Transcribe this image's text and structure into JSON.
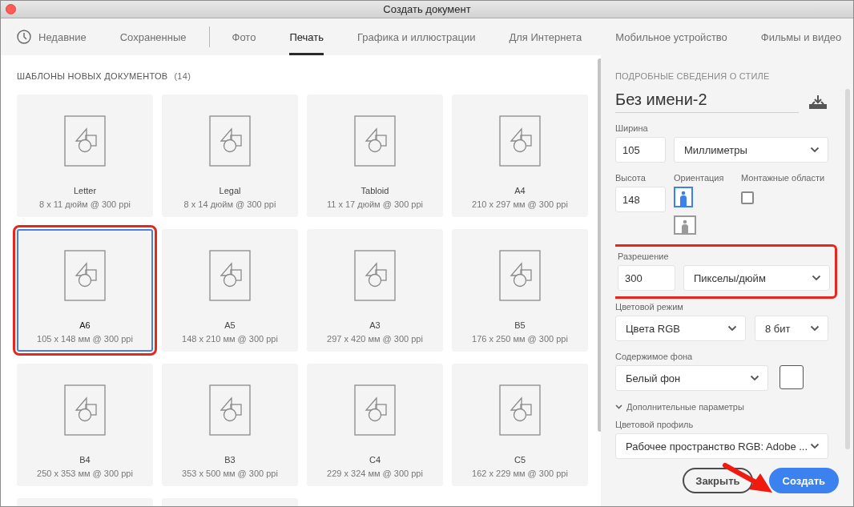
{
  "window": {
    "title": "Создать документ"
  },
  "tabs": [
    {
      "label": "Недавние",
      "kind": "recent",
      "selected": false
    },
    {
      "label": "Сохраненные",
      "kind": "plain",
      "selected": false
    },
    {
      "kind": "divider"
    },
    {
      "label": "Фото",
      "kind": "plain",
      "selected": false
    },
    {
      "label": "Печать",
      "kind": "plain",
      "selected": true
    },
    {
      "label": "Графика и иллюстрации",
      "kind": "plain",
      "selected": false
    },
    {
      "label": "Для Интернета",
      "kind": "plain",
      "selected": false
    },
    {
      "label": "Мобильное устройство",
      "kind": "plain",
      "selected": false
    },
    {
      "label": "Фильмы и видео",
      "kind": "plain",
      "selected": false
    }
  ],
  "templates": {
    "heading": "ШАБЛОНЫ НОВЫХ ДОКУМЕНТОВ",
    "count": "(14)",
    "items": [
      {
        "kind": "template",
        "name": "Letter",
        "size": "8 x 11 дюйм @ 300 ppi",
        "selected": false,
        "highlighted": false
      },
      {
        "kind": "template",
        "name": "Legal",
        "size": "8 x 14 дюйм @ 300 ppi",
        "selected": false,
        "highlighted": false
      },
      {
        "kind": "template",
        "name": "Tabloid",
        "size": "11 x 17 дюйм @ 300 ppi",
        "selected": false,
        "highlighted": false
      },
      {
        "kind": "template",
        "name": "A4",
        "size": "210 x 297 мм @ 300 ppi",
        "selected": false,
        "highlighted": false
      },
      {
        "kind": "template",
        "name": "A6",
        "size": "105 x 148 мм @ 300 ppi",
        "selected": true,
        "highlighted": true
      },
      {
        "kind": "template",
        "name": "A5",
        "size": "148 x 210 мм @ 300 ppi",
        "selected": false,
        "highlighted": false
      },
      {
        "kind": "template",
        "name": "A3",
        "size": "297 x 420 мм @ 300 ppi",
        "selected": false,
        "highlighted": false
      },
      {
        "kind": "template",
        "name": "B5",
        "size": "176 x 250 мм @ 300 ppi",
        "selected": false,
        "highlighted": false
      },
      {
        "kind": "template",
        "name": "B4",
        "size": "250 x 353 мм @ 300 ppi",
        "selected": false,
        "highlighted": false
      },
      {
        "kind": "template",
        "name": "B3",
        "size": "353 x 500 мм @ 300 ppi",
        "selected": false,
        "highlighted": false
      },
      {
        "kind": "template",
        "name": "C4",
        "size": "229 x 324 мм @ 300 ppi",
        "selected": false,
        "highlighted": false
      },
      {
        "kind": "template",
        "name": "C5",
        "size": "162 x 229 мм @ 300 ppi",
        "selected": false,
        "highlighted": false
      },
      {
        "kind": "cut_off"
      },
      {
        "kind": "cut_off"
      }
    ]
  },
  "details": {
    "heading": "ПОДРОБНЫЕ СВЕДЕНИЯ О СТИЛЕ",
    "doc_name": "Без имени-2",
    "width": {
      "label": "Ширина",
      "value": "105",
      "unit": "Миллиметры"
    },
    "height": {
      "label": "Высота",
      "value": "148"
    },
    "orientation": {
      "label": "Ориентация",
      "options": [
        {
          "kind": "portrait",
          "selected": true
        },
        {
          "kind": "landscape",
          "selected": false
        }
      ]
    },
    "artboards": {
      "label": "Монтажные области",
      "checked": false
    },
    "resolution": {
      "label": "Разрешение",
      "value": "300",
      "unit": "Пикселы/дюйм",
      "highlighted": true
    },
    "color_mode": {
      "label": "Цветовой режим",
      "mode": "Цвета RGB",
      "depth": "8 бит"
    },
    "background": {
      "label": "Содержимое фона",
      "value": "Белый фон",
      "color": "#ffffff"
    },
    "advanced": {
      "label": "Дополнительные параметры",
      "expanded": true
    },
    "profile": {
      "label": "Цветовой профиль",
      "value": "Рабочее пространство RGB: Adobe ..."
    }
  },
  "buttons": [
    {
      "label": "Закрыть",
      "kind": "secondary"
    },
    {
      "label": "Создать",
      "kind": "primary"
    }
  ],
  "annotation_arrow": true
}
